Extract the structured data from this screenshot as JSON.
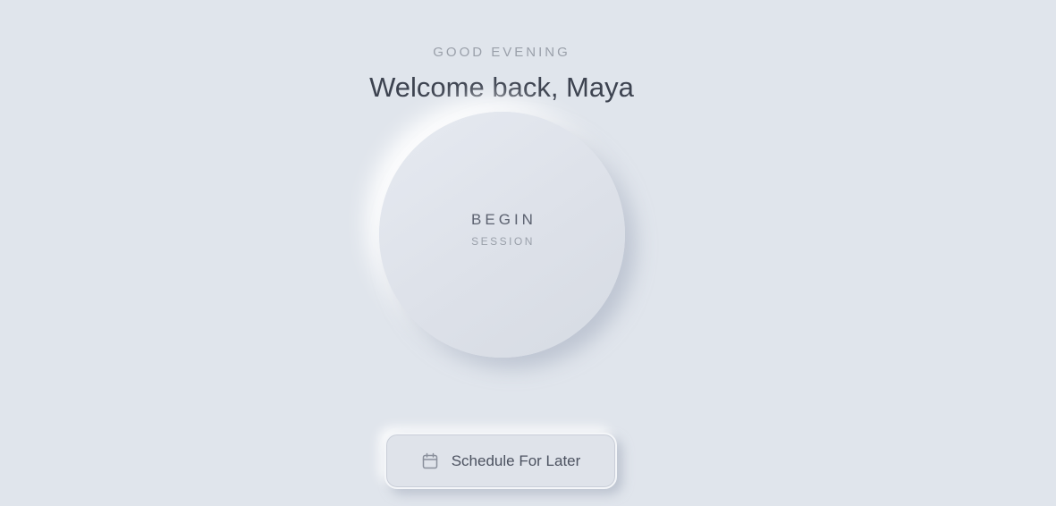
{
  "greeting": "GOOD EVENING",
  "welcome": "Welcome back, Maya",
  "session_button": {
    "title": "BEGIN",
    "subtitle": "SESSION"
  },
  "schedule_button": {
    "icon": "calendar-icon",
    "label": "Schedule For Later"
  },
  "colors": {
    "background": "#e0e5ec",
    "text_primary": "#3d4350",
    "text_muted": "#9aa0aa"
  }
}
